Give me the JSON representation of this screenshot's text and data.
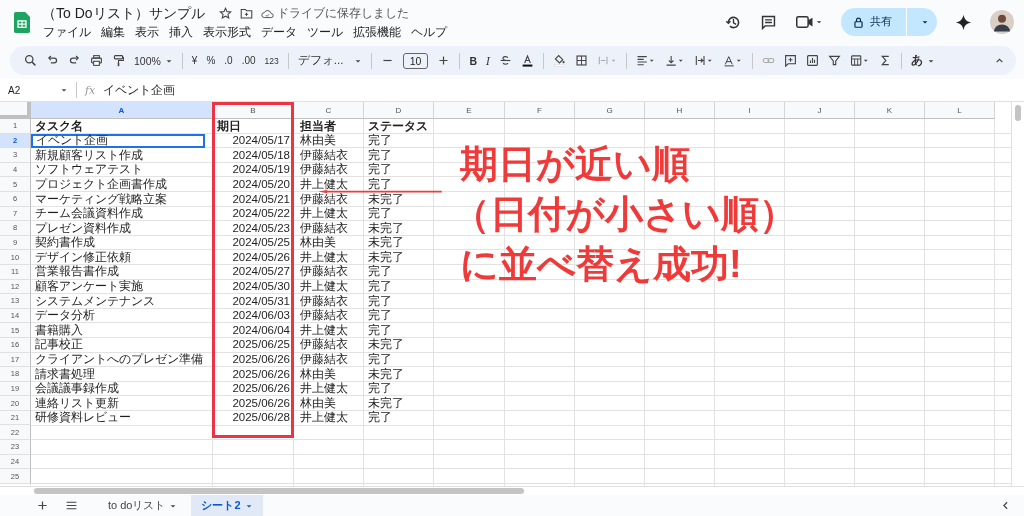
{
  "document": {
    "title": "（To Doリスト）サンプル",
    "save_status": "ドライブに保存しました"
  },
  "menu": [
    "ファイル",
    "編集",
    "表示",
    "挿入",
    "表示形式",
    "データ",
    "ツール",
    "拡張機能",
    "ヘルプ"
  ],
  "share_button": "共有",
  "toolbar": {
    "zoom": "100%",
    "currency": "¥",
    "percent": "%",
    "decrease_decimal": ".0",
    "increase_decimal": ".00",
    "number_format": "123",
    "font": "デフォ...",
    "font_size": "10",
    "bold": "B",
    "italic": "I",
    "input_mode": "あ"
  },
  "formula_bar": {
    "name_box": "A2",
    "fx": "fx",
    "value": "イベント企画"
  },
  "columns": [
    {
      "label": "A",
      "selected": true
    },
    {
      "label": "B",
      "selected": false
    },
    {
      "label": "C",
      "selected": false
    },
    {
      "label": "D",
      "selected": false
    },
    {
      "label": "E",
      "selected": false
    },
    {
      "label": "F",
      "selected": false
    },
    {
      "label": "G",
      "selected": false
    },
    {
      "label": "H",
      "selected": false
    },
    {
      "label": "I",
      "selected": false
    },
    {
      "label": "J",
      "selected": false
    },
    {
      "label": "K",
      "selected": false
    },
    {
      "label": "L",
      "selected": false
    }
  ],
  "rows": [
    {
      "number": "1",
      "kind": "header",
      "selected": false,
      "cells": [
        "タスク名",
        "期日",
        "担当者",
        "ステータス"
      ]
    },
    {
      "number": "2",
      "kind": "data",
      "selected": true,
      "cells": [
        "イベント企画",
        "2024/05/17",
        "林由美",
        "完了"
      ]
    },
    {
      "number": "3",
      "kind": "data",
      "selected": false,
      "cells": [
        "新規顧客リスト作成",
        "2024/05/18",
        "伊藤結衣",
        "完了"
      ]
    },
    {
      "number": "4",
      "kind": "data",
      "selected": false,
      "cells": [
        "ソフトウェアテスト",
        "2024/05/19",
        "伊藤結衣",
        "完了"
      ]
    },
    {
      "number": "5",
      "kind": "data",
      "selected": false,
      "cells": [
        "プロジェクト企画書作成",
        "2024/05/20",
        "井上健太",
        "完了"
      ]
    },
    {
      "number": "6",
      "kind": "data",
      "selected": false,
      "cells": [
        "マーケティング戦略立案",
        "2024/05/21",
        "伊藤結衣",
        "未完了"
      ]
    },
    {
      "number": "7",
      "kind": "data",
      "selected": false,
      "cells": [
        "チーム会議資料作成",
        "2024/05/22",
        "井上健太",
        "完了"
      ]
    },
    {
      "number": "8",
      "kind": "data",
      "selected": false,
      "cells": [
        "プレゼン資料作成",
        "2024/05/23",
        "伊藤結衣",
        "未完了"
      ]
    },
    {
      "number": "9",
      "kind": "data",
      "selected": false,
      "cells": [
        "契約書作成",
        "2024/05/25",
        "林由美",
        "未完了"
      ]
    },
    {
      "number": "10",
      "kind": "data",
      "selected": false,
      "cells": [
        "デザイン修正依頼",
        "2024/05/26",
        "井上健太",
        "未完了"
      ]
    },
    {
      "number": "11",
      "kind": "data",
      "selected": false,
      "cells": [
        "営業報告書作成",
        "2024/05/27",
        "伊藤結衣",
        "完了"
      ]
    },
    {
      "number": "12",
      "kind": "data",
      "selected": false,
      "cells": [
        "顧客アンケート実施",
        "2024/05/30",
        "井上健太",
        "完了"
      ]
    },
    {
      "number": "13",
      "kind": "data",
      "selected": false,
      "cells": [
        "システムメンテナンス",
        "2024/05/31",
        "伊藤結衣",
        "完了"
      ]
    },
    {
      "number": "14",
      "kind": "data",
      "selected": false,
      "cells": [
        "データ分析",
        "2024/06/03",
        "伊藤結衣",
        "完了"
      ]
    },
    {
      "number": "15",
      "kind": "data",
      "selected": false,
      "cells": [
        "書籍購入",
        "2024/06/04",
        "井上健太",
        "完了"
      ]
    },
    {
      "number": "16",
      "kind": "data",
      "selected": false,
      "cells": [
        "記事校正",
        "2025/06/25",
        "伊藤結衣",
        "未完了"
      ]
    },
    {
      "number": "17",
      "kind": "data",
      "selected": false,
      "cells": [
        "クライアントへのプレゼン準備",
        "2025/06/26",
        "伊藤結衣",
        "完了"
      ]
    },
    {
      "number": "18",
      "kind": "data",
      "selected": false,
      "cells": [
        "請求書処理",
        "2025/06/26",
        "林由美",
        "未完了"
      ]
    },
    {
      "number": "19",
      "kind": "data",
      "selected": false,
      "cells": [
        "会議議事録作成",
        "2025/06/26",
        "井上健太",
        "完了"
      ]
    },
    {
      "number": "20",
      "kind": "data",
      "selected": false,
      "cells": [
        "連絡リスト更新",
        "2025/06/26",
        "林由美",
        "未完了"
      ]
    },
    {
      "number": "21",
      "kind": "data",
      "selected": false,
      "cells": [
        "研修資料レビュー",
        "2025/06/28",
        "井上健太",
        "完了"
      ]
    },
    {
      "number": "22",
      "kind": "empty",
      "selected": false
    },
    {
      "number": "23",
      "kind": "empty",
      "selected": false
    },
    {
      "number": "24",
      "kind": "empty",
      "selected": false
    },
    {
      "number": "25",
      "kind": "empty",
      "selected": false
    }
  ],
  "annotation": [
    "期日が近い順",
    "（日付が小さい順）",
    "に並べ替え成功!"
  ],
  "sheet_tabs": [
    {
      "label": "to doリスト",
      "selected": false
    },
    {
      "label": "シート2",
      "selected": true
    }
  ]
}
